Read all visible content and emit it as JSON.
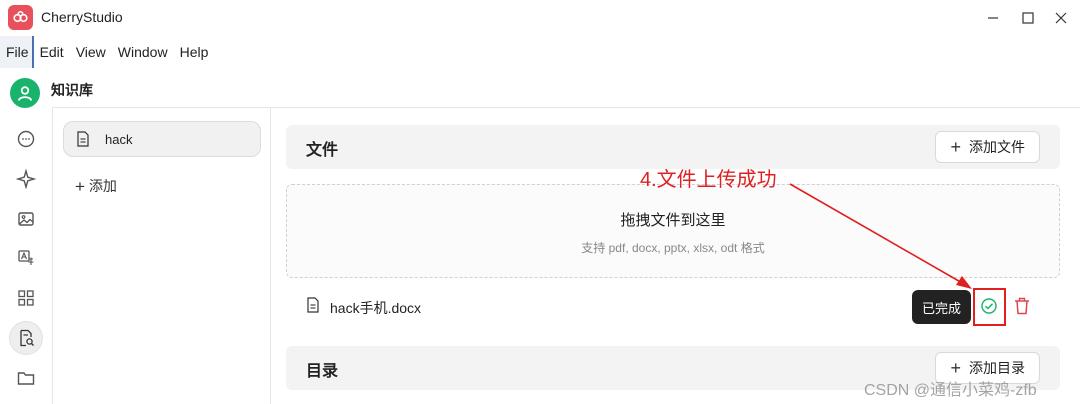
{
  "app": {
    "title": "CherryStudio"
  },
  "menu": {
    "items": [
      "File",
      "Edit",
      "View",
      "Window",
      "Help"
    ]
  },
  "header": {
    "title": "知识库"
  },
  "sidebar": {
    "items": [
      {
        "label": "hack"
      }
    ],
    "add_label": "添加"
  },
  "files_section": {
    "title": "文件",
    "add_button": "添加文件"
  },
  "dropzone": {
    "title": "拖拽文件到这里",
    "subtitle": "支持 pdf, docx, pptx, xlsx, odt 格式"
  },
  "file_list": [
    {
      "name": "hack手机.docx",
      "status_tooltip": "已完成"
    }
  ],
  "dir_section": {
    "title": "目录",
    "add_button": "添加目录"
  },
  "annotation": {
    "text": "4.文件上传成功"
  },
  "watermark": "CSDN @通信小菜鸡-zfb",
  "colors": {
    "accent_green": "#19b36b",
    "annotation_red": "#e02020",
    "delete_red": "#e0454f",
    "logo": "#e8505b"
  },
  "icons": {
    "rail": [
      "chat-bubble-icon",
      "sparkle-icon",
      "image-icon",
      "translate-icon",
      "apps-grid-icon",
      "knowledge-search-icon",
      "folder-icon"
    ]
  }
}
